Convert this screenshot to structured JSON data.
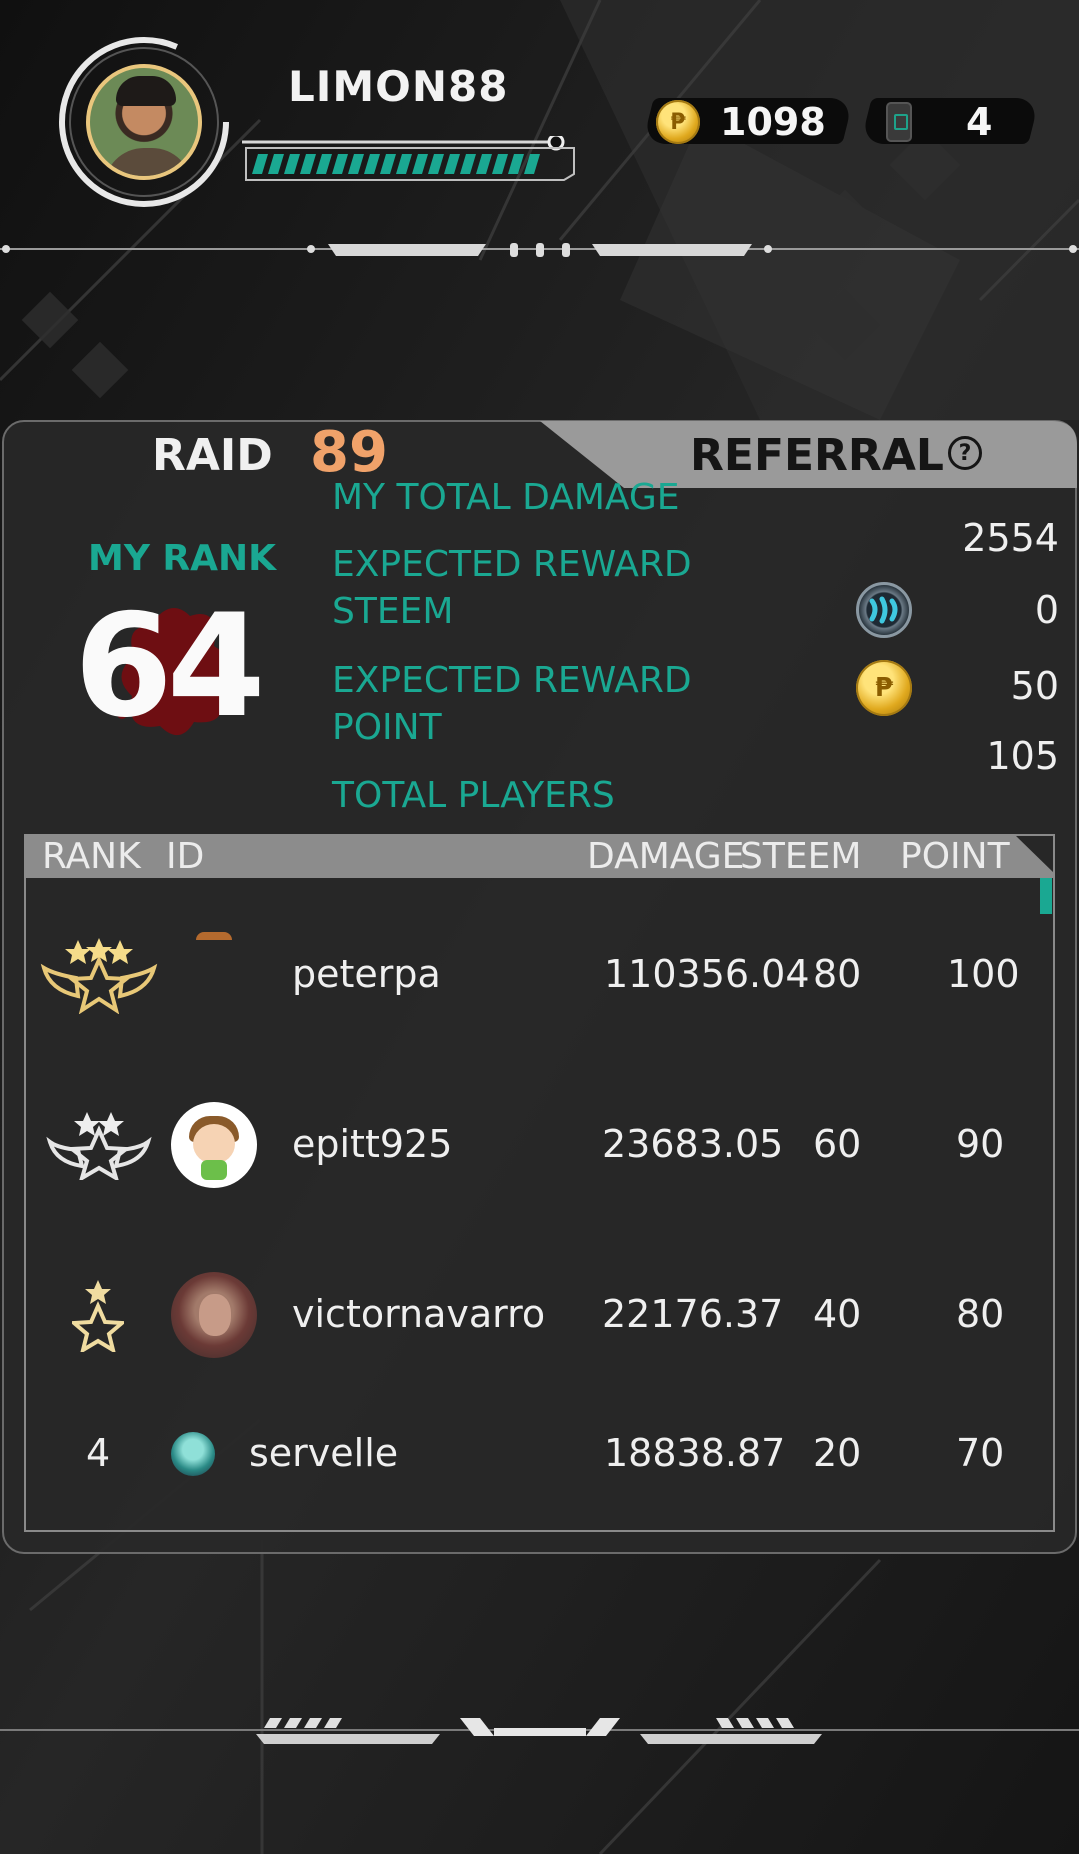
{
  "colors": {
    "accent": "#1aa892",
    "raid_count": "#f0a26a",
    "background": "#1c1c1c"
  },
  "player": {
    "username": "LIMON88",
    "avatar": "profile-photo",
    "coins": "1098",
    "tickets": "4",
    "level_progress": 0.95
  },
  "tabs": {
    "raid": {
      "label": "RAID",
      "count": "89"
    },
    "referral": {
      "label": "REFERRAL",
      "help_icon": "question-circle-icon",
      "help_symbol": "?"
    }
  },
  "summary": {
    "my_rank_label": "MY RANK",
    "my_rank": "64",
    "total_damage_label": "MY TOTAL DAMAGE",
    "total_damage": "2554",
    "reward_steem_label_1": "EXPECTED REWARD",
    "reward_steem_label_2": "STEEM",
    "reward_steem": "0",
    "reward_point_label_1": "EXPECTED REWARD",
    "reward_point_label_2": "POINT",
    "reward_point": "50",
    "total_players_label": "TOTAL PLAYERS",
    "total_players": "105"
  },
  "table": {
    "headers": {
      "rank": "RANK",
      "id": "ID",
      "damage": "DAMAGE",
      "steem": "STEEM",
      "point": "POINT"
    },
    "rows": [
      {
        "rank": "1",
        "badge": "gold-winged-star-badge-icon",
        "id": "peterpa",
        "damage": "110356.04",
        "steem": "80",
        "point": "100"
      },
      {
        "rank": "2",
        "badge": "silver-winged-star-badge-icon",
        "id": "epitt925",
        "damage": "23683.05",
        "steem": "60",
        "point": "90"
      },
      {
        "rank": "3",
        "badge": "bronze-star-badge-icon",
        "id": "victornavarro",
        "damage": "22176.37",
        "steem": "40",
        "point": "80"
      },
      {
        "rank": "4",
        "id": "servelle",
        "damage": "18838.87",
        "steem": "20",
        "point": "70"
      }
    ]
  }
}
